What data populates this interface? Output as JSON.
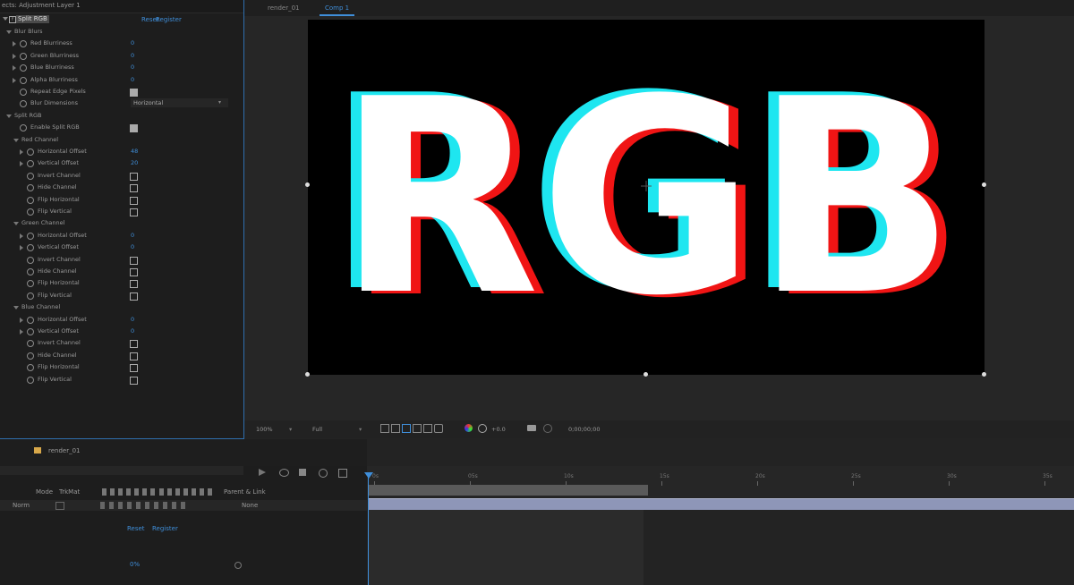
{
  "effects_panel": {
    "header_title": "ects: Adjustment Layer 1",
    "effect_name": "Split RGB",
    "reset_label": "Reset",
    "register_label": "Register",
    "rows": [
      {
        "label": "Blur Blurs",
        "value": "",
        "type": "group",
        "indent": 8
      },
      {
        "label": "Red Blurriness",
        "value": "0",
        "type": "prop",
        "indent": 22
      },
      {
        "label": "Green Blurriness",
        "value": "0",
        "type": "prop",
        "indent": 22
      },
      {
        "label": "Blue Blurriness",
        "value": "0",
        "type": "prop",
        "indent": 22
      },
      {
        "label": "Alpha Blurriness",
        "value": "0",
        "type": "prop",
        "indent": 22
      },
      {
        "label": "Repeat Edge Pixels",
        "value": "",
        "type": "check-on",
        "indent": 22
      },
      {
        "label": "Blur Dimensions",
        "value": "Horizontal",
        "type": "dropdown",
        "indent": 22
      },
      {
        "label": "Split RGB",
        "value": "",
        "type": "group",
        "indent": 8
      },
      {
        "label": "Enable Split RGB",
        "value": "",
        "type": "check-on",
        "indent": 22
      },
      {
        "label": "Red Channel",
        "value": "",
        "type": "group",
        "indent": 16
      },
      {
        "label": "Horizontal Offset",
        "value": "48",
        "type": "prop",
        "indent": 30
      },
      {
        "label": "Vertical Offset",
        "value": "20",
        "type": "prop",
        "indent": 30
      },
      {
        "label": "Invert Channel",
        "value": "",
        "type": "check",
        "indent": 30
      },
      {
        "label": "Hide Channel",
        "value": "",
        "type": "check",
        "indent": 30
      },
      {
        "label": "Flip Horizontal",
        "value": "",
        "type": "check",
        "indent": 30
      },
      {
        "label": "Flip Vertical",
        "value": "",
        "type": "check",
        "indent": 30
      },
      {
        "label": "Green Channel",
        "value": "",
        "type": "group",
        "indent": 16
      },
      {
        "label": "Horizontal Offset",
        "value": "0",
        "type": "prop",
        "indent": 30
      },
      {
        "label": "Vertical Offset",
        "value": "0",
        "type": "prop",
        "indent": 30
      },
      {
        "label": "Invert Channel",
        "value": "",
        "type": "check",
        "indent": 30
      },
      {
        "label": "Hide Channel",
        "value": "",
        "type": "check",
        "indent": 30
      },
      {
        "label": "Flip Horizontal",
        "value": "",
        "type": "check",
        "indent": 30
      },
      {
        "label": "Flip Vertical",
        "value": "",
        "type": "check",
        "indent": 30
      },
      {
        "label": "Blue Channel",
        "value": "",
        "type": "group",
        "indent": 16
      },
      {
        "label": "Horizontal Offset",
        "value": "0",
        "type": "prop",
        "indent": 30
      },
      {
        "label": "Vertical Offset",
        "value": "0",
        "type": "prop",
        "indent": 30
      },
      {
        "label": "Invert Channel",
        "value": "",
        "type": "check",
        "indent": 30
      },
      {
        "label": "Hide Channel",
        "value": "",
        "type": "check",
        "indent": 30
      },
      {
        "label": "Flip Horizontal",
        "value": "",
        "type": "check",
        "indent": 30
      },
      {
        "label": "Flip Vertical",
        "value": "",
        "type": "check",
        "indent": 30
      }
    ]
  },
  "composition": {
    "tab_1": "render_01",
    "tab_2": "Comp 1",
    "canvas_text": "RGB",
    "colors": {
      "cyan": "#1ee6f0",
      "red": "#f01414",
      "white": "#ffffff",
      "background": "#000000"
    }
  },
  "viewer_toolbar": {
    "zoom": "100%",
    "resolution": "Full",
    "exposure": "+0.0",
    "timecode": "0;00;00;00"
  },
  "project": {
    "item_name": "render_01"
  },
  "timeline": {
    "mode_label": "Mode",
    "trkmat_label": "TrkMat",
    "parent_label": "Parent & Link",
    "mode_value": "Norm",
    "parent_value": "None",
    "reset_label": "Reset",
    "register_label": "Register",
    "value_label": "0%",
    "ruler_ticks": [
      "0s",
      "05s",
      "10s",
      "15s",
      "20s",
      "25s",
      "30s",
      "35s"
    ]
  }
}
